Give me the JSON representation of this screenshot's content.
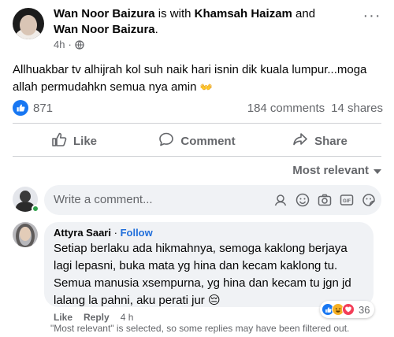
{
  "post": {
    "author": "Wan Noor Baizura",
    "with_text": "is with",
    "tagged_1": "Khamsah Haizam",
    "and_text": "and",
    "tagged_2": "Wan Noor Baizura",
    "period": ".",
    "time": "4h",
    "dot": "·",
    "body": "Allhuakbar tv alhijrah kol suh naik hari isnin dik kuala lumpur...moga allah permudahkn semua nya amin",
    "body_emoji": "👐",
    "reaction_count": "871",
    "comments_count": "184 comments",
    "shares_count": "14 shares"
  },
  "actions": {
    "like": "Like",
    "comment": "Comment",
    "share": "Share"
  },
  "sort": {
    "label": "Most relevant"
  },
  "composer": {
    "placeholder": "Write a comment..."
  },
  "comment": {
    "author": "Attyra Saari",
    "dot": "·",
    "follow": "Follow",
    "text": "Setiap berlaku ada hikmahnya, semoga kaklong berjaya lagi lepasni, buka mata yg hina dan kecam kaklong tu. Semua manusia xsempurna, yg hina dan kecam tu jgn jd lalang la pahni, aku perati jur",
    "emoji": "😔",
    "reaction_count": "36",
    "like": "Like",
    "reply": "Reply",
    "time": "4 h"
  },
  "filter_note": "\"Most relevant\" is selected, so some replies may have been filtered out.",
  "icons": [
    "globe-icon",
    "more-icon",
    "like-icon",
    "comment-icon",
    "share-icon",
    "emoji-icon",
    "sticker-icon",
    "camera-icon",
    "gif-icon",
    "avatar-sticker-icon"
  ],
  "colors": {
    "facebook_blue": "#1877f2",
    "secondary_text": "#65676b",
    "input_bg": "#f0f2f5",
    "online_green": "#31a24c"
  }
}
